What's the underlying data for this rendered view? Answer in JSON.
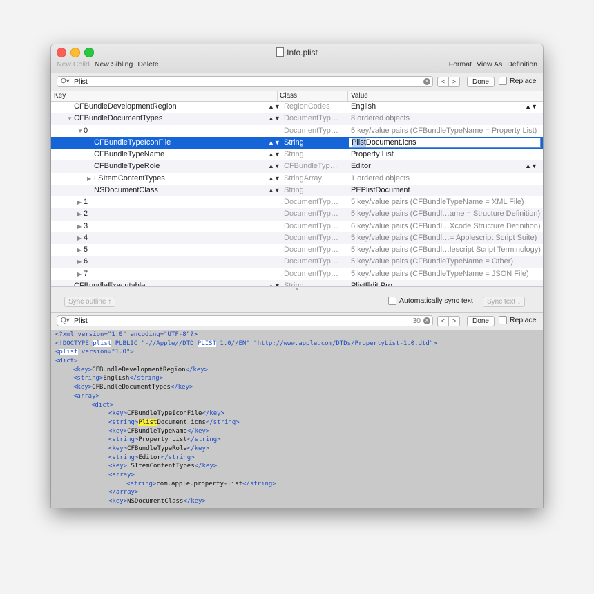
{
  "window": {
    "title": "Info.plist"
  },
  "toolbar": {
    "new_child": "New Child",
    "new_sibling": "New Sibling",
    "delete": "Delete",
    "format": "Format",
    "view_as": "View As",
    "definition": "Definition"
  },
  "search_top": {
    "glyph": "Q▾",
    "value": "Plist",
    "prev": "<",
    "next": ">",
    "done": "Done",
    "replace": "Replace"
  },
  "columns": {
    "key": "Key",
    "class": "Class",
    "value": "Value"
  },
  "rows": [
    {
      "key": "CFBundleDevelopmentRegion",
      "class": "RegionCodes",
      "value": "English"
    },
    {
      "key": "CFBundleDocumentTypes",
      "class": "DocumentTyp…",
      "value": "8 ordered objects"
    },
    {
      "key": "0",
      "class": "DocumentTyp…",
      "value": "5 key/value pairs (CFBundleTypeName = Property List)"
    },
    {
      "key": "CFBundleTypeIconFile",
      "class": "String",
      "value_hl": "Plist",
      "value_rest": "Document.icns"
    },
    {
      "key": "CFBundleTypeName",
      "class": "String",
      "value": "Property List"
    },
    {
      "key": "CFBundleTypeRole",
      "class": "CFBundleTyp…",
      "value": "Editor"
    },
    {
      "key": "LSItemContentTypes",
      "class": "StringArray",
      "value": "1 ordered objects"
    },
    {
      "key": "NSDocumentClass",
      "class": "String",
      "value": "PEPlistDocument"
    },
    {
      "key": "1",
      "class": "DocumentTyp…",
      "value": "5 key/value pairs (CFBundleTypeName = XML File)"
    },
    {
      "key": "2",
      "class": "DocumentTyp…",
      "value": "5 key/value pairs (CFBundl…ame = Structure Definition)"
    },
    {
      "key": "3",
      "class": "DocumentTyp…",
      "value": "6 key/value pairs (CFBundl…Xcode Structure Definition)"
    },
    {
      "key": "4",
      "class": "DocumentTyp…",
      "value": "5 key/value pairs (CFBundl…= Applescript Script Suite)"
    },
    {
      "key": "5",
      "class": "DocumentTyp…",
      "value": "5 key/value pairs (CFBundl…lescript Script Terminology)"
    },
    {
      "key": "6",
      "class": "DocumentTyp…",
      "value": "5 key/value pairs (CFBundleTypeName = Other)"
    },
    {
      "key": "7",
      "class": "DocumentTyp…",
      "value": "5 key/value pairs (CFBundleTypeName = JSON File)"
    },
    {
      "key": "CFBundleExecutable",
      "class": "String",
      "value": "PlistEdit Pro"
    }
  ],
  "sync": {
    "sync_outline": "Sync outline ↑",
    "auto_sync": "Automatically sync text",
    "sync_text": "Sync text ↓"
  },
  "search_bottom": {
    "glyph": "Q▾",
    "value": "Plist",
    "count": "30",
    "prev": "<",
    "next": ">",
    "done": "Done",
    "replace": "Replace"
  },
  "source": {
    "l1": "<?xml version=\"1.0\" encoding=\"UTF-8\"?>",
    "l2a": "<!DOCTYPE ",
    "l2b": "plist",
    "l2c": " PUBLIC \"-//Apple//DTD ",
    "l2d": "PLIST",
    "l2e": " 1.0//EN\" \"http://www.apple.com/DTDs/PropertyList-1.0.dtd\">",
    "l3a": "<",
    "l3b": "plist",
    "l3c": " version=\"1.0\">",
    "l4": "<dict>",
    "l5a": "<key>",
    "l5b": "CFBundleDevelopmentRegion",
    "l5c": "</key>",
    "l6a": "<string>",
    "l6b": "English",
    "l6c": "</string>",
    "l7a": "<key>",
    "l7b": "CFBundleDocumentTypes",
    "l7c": "</key>",
    "l8": "<array>",
    "l9": "<dict>",
    "l10a": "<key>",
    "l10b": "CFBundleTypeIconFile",
    "l10c": "</key>",
    "l11a": "<string>",
    "l11b": "Plist",
    "l11c": "Document.icns",
    "l11d": "</string>",
    "l12a": "<key>",
    "l12b": "CFBundleTypeName",
    "l12c": "</key>",
    "l13a": "<string>",
    "l13b": "Property List",
    "l13c": "</string>",
    "l14a": "<key>",
    "l14b": "CFBundleTypeRole",
    "l14c": "</key>",
    "l15a": "<string>",
    "l15b": "Editor",
    "l15c": "</string>",
    "l16a": "<key>",
    "l16b": "LSItemContentTypes",
    "l16c": "</key>",
    "l17": "<array>",
    "l18a": "<string>",
    "l18b": "com.apple.property-list",
    "l18c": "</string>",
    "l19": "</array>",
    "l20a": "<key>",
    "l20b": "NSDocumentClass",
    "l20c": "</key>"
  }
}
